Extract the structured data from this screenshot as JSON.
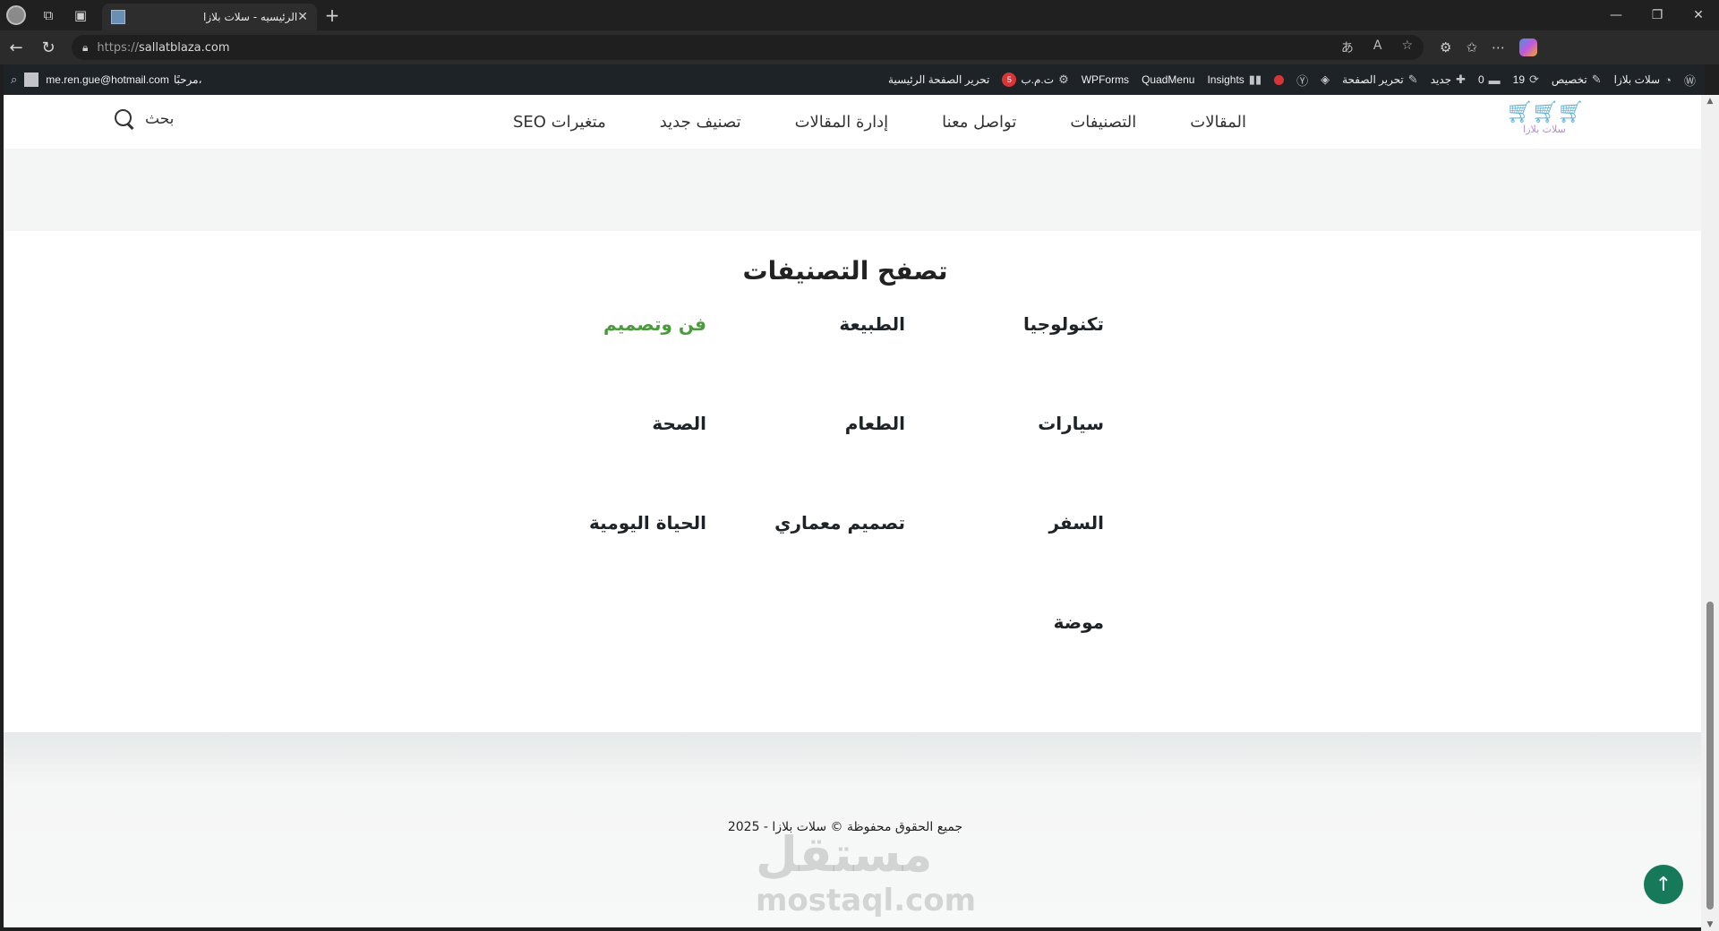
{
  "browser": {
    "tab_title": "الرئيسيه - سلات بلازا",
    "tab_close": "✕",
    "new_tab": "+",
    "url_proto": "https://",
    "url_host": "sallatblaza.com",
    "win_min": "—",
    "win_max": "❐",
    "win_close": "✕"
  },
  "wpbar": {
    "site_name": "سلات بلازا",
    "customize": "تخصيص",
    "updates_count": "19",
    "comments_count": "0",
    "new_label": "جديد",
    "edit_page": "تحرير الصفحة",
    "insights": "Insights",
    "quadmenu": "QuadMenu",
    "wpforms": "WPForms",
    "seo_label": "ت.م.ب",
    "seo_badge": "5",
    "edit_home": "تحرير الصفحة الرئيسية",
    "greeting": "مرحبًا،",
    "user_email": "me.ren.gue@hotmail.com"
  },
  "header": {
    "logo_text": "سلات بلازا",
    "nav": [
      "المقالات",
      "التصنيفات",
      "تواصل معنا",
      "إدارة المقالات",
      "تصنيف جديد",
      "متغيرات SEO"
    ],
    "search_label": "بحث"
  },
  "categories": {
    "title": "تصفح التصنيفات",
    "items": [
      "تكنولوجيا",
      "الطبيعة",
      "فن وتصميم",
      "سيارات",
      "الطعام",
      "الصحة",
      "السفر",
      "تصميم معماري",
      "الحياة اليومية",
      "موضة"
    ],
    "active": "فن وتصميم"
  },
  "footer": {
    "copyright": "جميع الحقوق محفوظة © سلات بلازا - 2025",
    "watermark_ar": "مستقل",
    "watermark_en": "mostaql.com"
  },
  "colors": {
    "accent_green": "#4c9a3e",
    "to_top_bg": "#15795a",
    "wp_bar": "#1d2327"
  }
}
